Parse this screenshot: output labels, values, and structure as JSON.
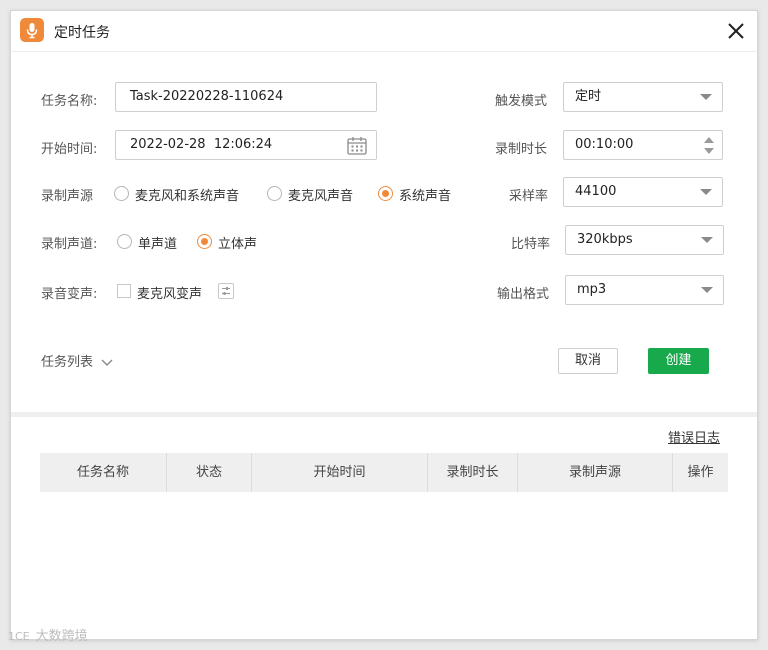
{
  "window": {
    "title": "定时任务"
  },
  "form": {
    "task_name": {
      "label": "任务名称:",
      "value": "Task-20220228-110624"
    },
    "start_time": {
      "label": "开始时间:",
      "value": "2022-02-28  12:06:24"
    },
    "source": {
      "label": "录制声源",
      "options": [
        {
          "label": "麦克风和系统声音",
          "selected": false
        },
        {
          "label": "麦克风声音",
          "selected": false
        },
        {
          "label": "系统声音",
          "selected": true
        }
      ]
    },
    "channel": {
      "label": "录制声道:",
      "options": [
        {
          "label": "单声道",
          "selected": false
        },
        {
          "label": "立体声",
          "selected": true
        }
      ]
    },
    "voice_change": {
      "label": "录音变声:",
      "option_label": "麦克风变声",
      "checked": false
    },
    "trigger_mode": {
      "label": "触发模式",
      "value": "定时"
    },
    "duration": {
      "label": "录制时长",
      "value": "00:10:00"
    },
    "sample_rate": {
      "label": "采样率",
      "value": "44100"
    },
    "bitrate": {
      "label": "比特率",
      "value": "320kbps"
    },
    "format": {
      "label": "输出格式",
      "value": "mp3"
    }
  },
  "actions": {
    "task_list": "任务列表",
    "cancel": "取消",
    "create": "创建"
  },
  "tasks": {
    "error_log": "错误日志",
    "columns": [
      "任务名称",
      "状态",
      "开始时间",
      "录制时长",
      "录制声源",
      "操作"
    ],
    "rows": []
  },
  "watermark": "大数跨境",
  "colors": {
    "accent": "#f08a3a",
    "primary_button": "#18a94c"
  },
  "icons": {
    "app": "microphone-icon",
    "close": "close-icon",
    "calendar": "calendar-icon",
    "expand": "chevron-down-icon"
  }
}
